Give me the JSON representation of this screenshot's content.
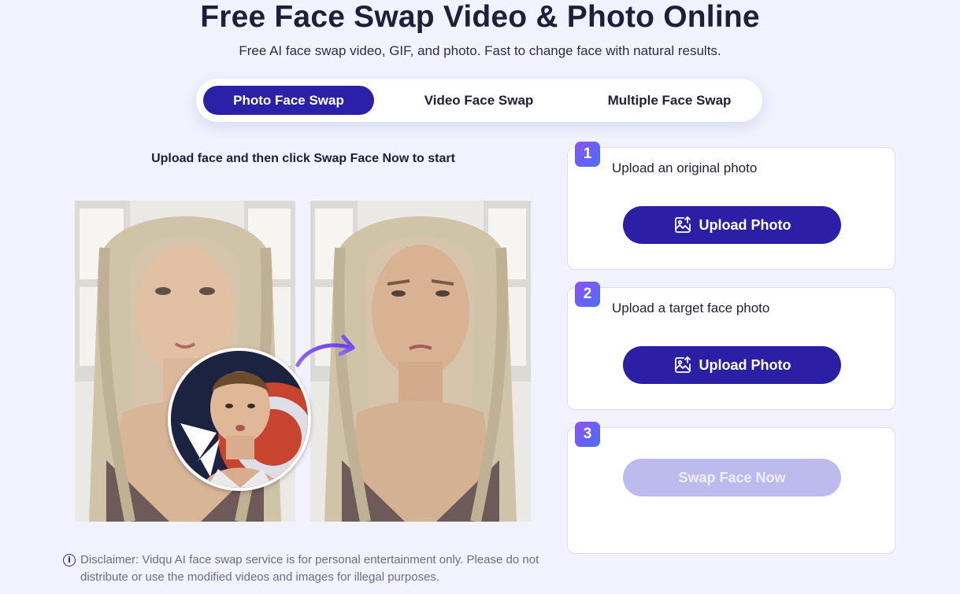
{
  "header": {
    "title": "Free Face Swap Video & Photo Online",
    "subtitle": "Free AI face swap video, GIF, and photo. Fast to change face with natural results."
  },
  "tabs": [
    {
      "label": "Photo Face Swap",
      "active": true
    },
    {
      "label": "Video Face Swap",
      "active": false
    },
    {
      "label": "Multiple Face Swap",
      "active": false
    }
  ],
  "demo": {
    "instruction": "Upload face and then click Swap Face Now to start"
  },
  "disclaimer": {
    "text": "Disclaimer: Vidqu AI face swap service is for personal entertainment only. Please do not distribute or use the modified videos and images for illegal purposes."
  },
  "steps": [
    {
      "number": "1",
      "label": "Upload an original photo",
      "button": "Upload Photo"
    },
    {
      "number": "2",
      "label": "Upload a target face photo",
      "button": "Upload Photo"
    },
    {
      "number": "3",
      "label": "",
      "button": "Swap Face Now",
      "disabled": true
    }
  ],
  "colors": {
    "primary": "#2a21a8",
    "background": "#f1f2fd",
    "disabled_button": "#bdbbee",
    "step_gradient_start": "#8a52f7",
    "step_gradient_end": "#4c6ef5"
  }
}
